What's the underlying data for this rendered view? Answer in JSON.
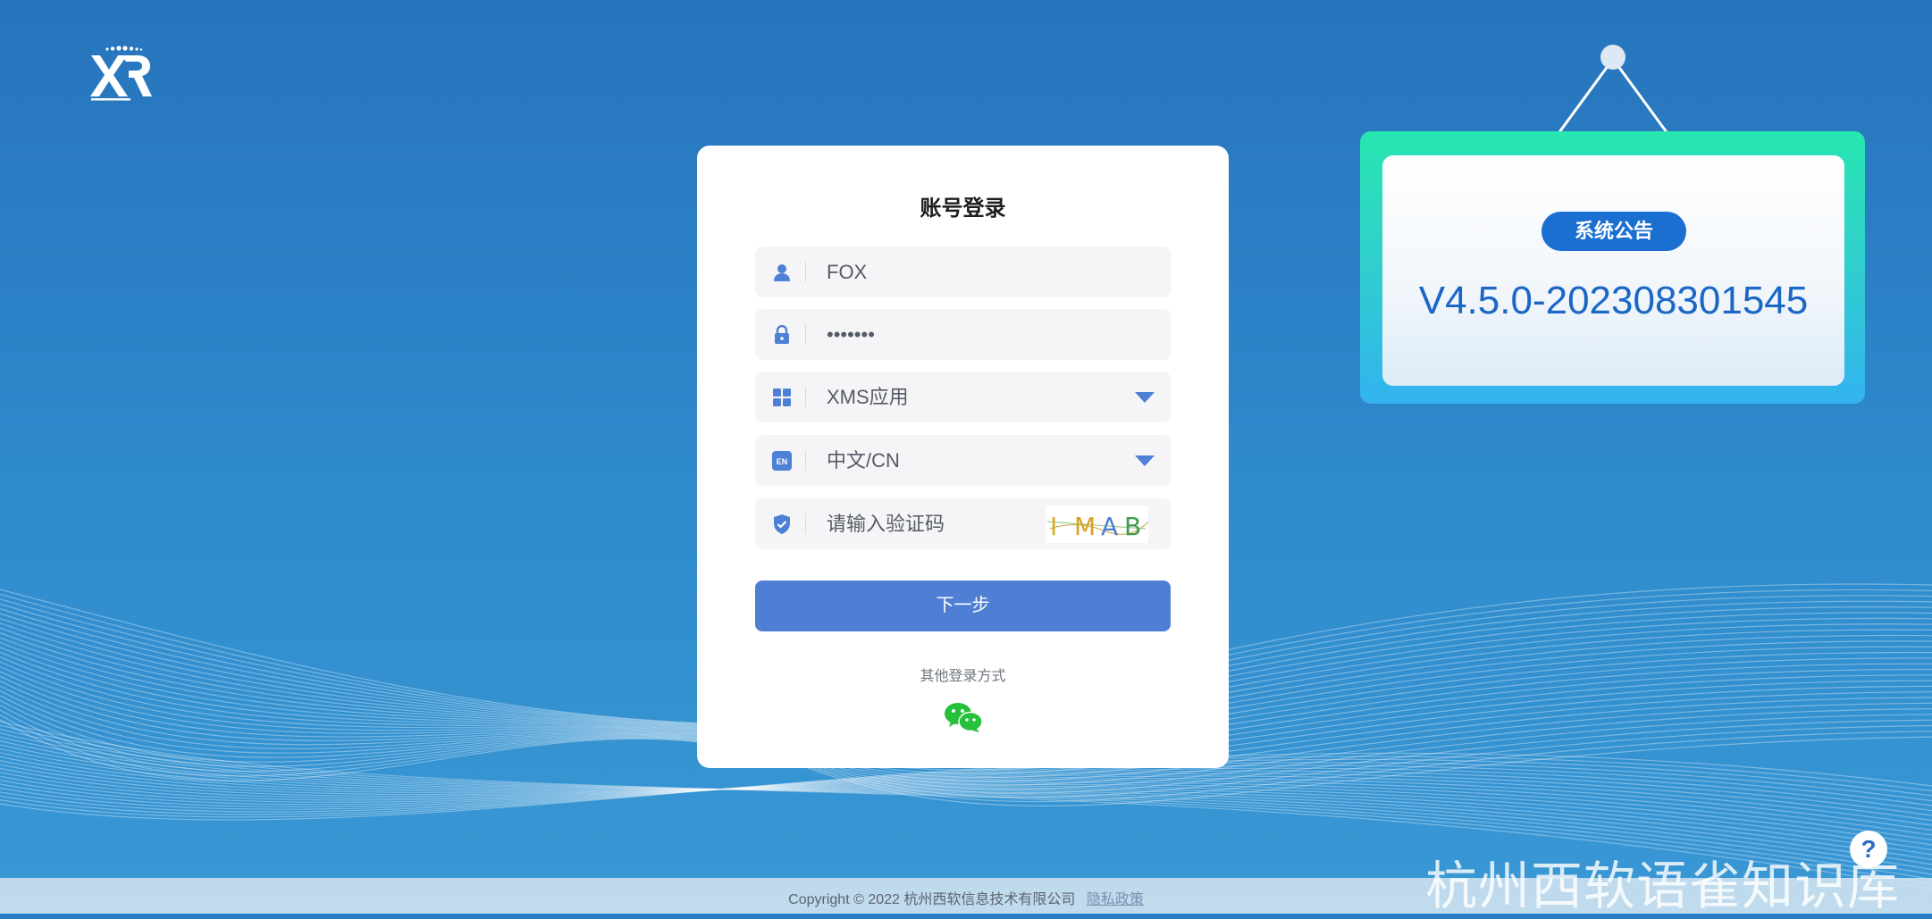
{
  "login": {
    "title": "账号登录",
    "username_value": "FOX",
    "password_value": "•••••••",
    "app_select_value": "XMS应用",
    "language_select_value": "中文/CN",
    "language_icon_text": "EN",
    "captcha_placeholder": "请输入验证码",
    "captcha_image_text": "IMAB",
    "next_button_label": "下一步",
    "other_login_label": "其他登录方式"
  },
  "notice": {
    "badge_label": "系统公告",
    "version": "V4.5.0-202308301545"
  },
  "footer": {
    "copyright": "Copyright © 2022 杭州西软信息技术有限公司",
    "privacy_link": "隐私政策"
  },
  "watermark": "杭州西软语雀知识库",
  "help_label": "?",
  "colors": {
    "primary": "#4f7fd4",
    "badge": "#1a6fd0",
    "wechat": "#25c13a",
    "board_top": "#27e6b0",
    "board_bottom": "#33b3ef"
  },
  "icons": [
    "user-icon",
    "lock-icon",
    "grid-icon",
    "language-icon",
    "shield-check-icon",
    "wechat-icon",
    "help-icon"
  ]
}
